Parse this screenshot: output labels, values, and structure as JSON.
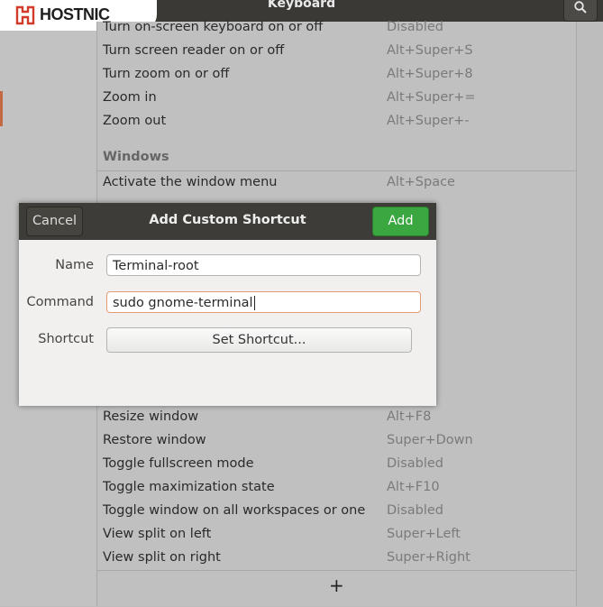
{
  "window": {
    "title": "Keyboard"
  },
  "logo": {
    "text": "HOSTNIC"
  },
  "shortcuts_top": [
    {
      "name": "Turn on-screen keyboard on or off",
      "accel": "Disabled"
    },
    {
      "name": "Turn screen reader on or off",
      "accel": "Alt+Super+S"
    },
    {
      "name": "Turn zoom on or off",
      "accel": "Alt+Super+8"
    },
    {
      "name": "Zoom in",
      "accel": "Alt+Super+="
    },
    {
      "name": "Zoom out",
      "accel": "Alt+Super+-"
    }
  ],
  "windows_section": {
    "label": "Windows"
  },
  "shortcuts_windows_visible": [
    {
      "name": "Activate the window menu",
      "accel": "Alt+Space"
    }
  ],
  "shortcuts_bottom": [
    {
      "name": "Resize window",
      "accel": "Alt+F8"
    },
    {
      "name": "Restore window",
      "accel": "Super+Down"
    },
    {
      "name": "Toggle fullscreen mode",
      "accel": "Disabled"
    },
    {
      "name": "Toggle maximization state",
      "accel": "Alt+F10"
    },
    {
      "name": "Toggle window on all workspaces or one",
      "accel": "Disabled"
    },
    {
      "name": "View split on left",
      "accel": "Super+Left"
    },
    {
      "name": "View split on right",
      "accel": "Super+Right"
    }
  ],
  "add_button": {
    "label": "+"
  },
  "dialog": {
    "title": "Add Custom Shortcut",
    "cancel": "Cancel",
    "add": "Add",
    "name_label": "Name",
    "name_value": "Terminal-root",
    "command_label": "Command",
    "command_value": "sudo gnome-terminal",
    "shortcut_label": "Shortcut",
    "set_shortcut": "Set Shortcut..."
  },
  "colors": {
    "accent": "#3aa741",
    "focus": "#e49a73",
    "sidebar_mark": "#c16a44"
  }
}
